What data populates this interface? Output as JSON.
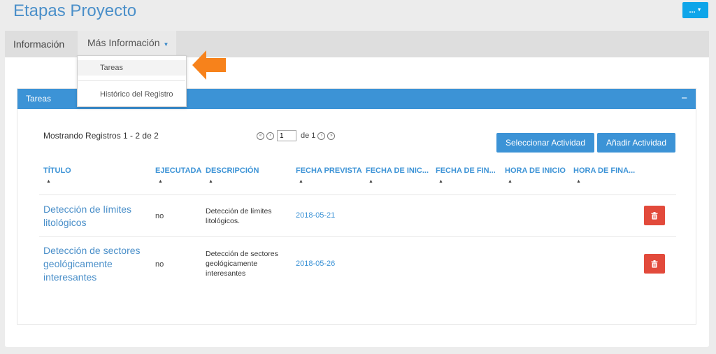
{
  "header": {
    "title": "Etapas Proyecto",
    "menu_label": "...",
    "menu_caret": "▼"
  },
  "tabs": [
    {
      "label": "Información"
    },
    {
      "label": "Más Información",
      "caret": "▼"
    }
  ],
  "dropdown": {
    "items": [
      {
        "label": "Tareas"
      },
      {
        "label": "Histórico del Registro"
      }
    ]
  },
  "panel": {
    "title": "Tareas",
    "collapse_symbol": "−",
    "records_info": "Mostrando Registros 1 - 2 de 2",
    "pager": {
      "first": "«",
      "prev": "‹",
      "current_page": "1",
      "of_label": "de 1",
      "next": "›",
      "last": "»"
    },
    "buttons": {
      "select_activity": "Seleccionar Actividad",
      "add_activity": "Añadir Actividad"
    },
    "columns": [
      {
        "label": "TÍTULO",
        "sort": "▲"
      },
      {
        "label": "EJECUTADA",
        "sort": "▲"
      },
      {
        "label": "DESCRIPCIÓN",
        "sort": "▲"
      },
      {
        "label": "FECHA PREVISTA",
        "sort": "▲"
      },
      {
        "label": "FECHA DE INIC...",
        "sort": "▲"
      },
      {
        "label": "FECHA DE FIN...",
        "sort": "▲"
      },
      {
        "label": "HORA DE INICIO",
        "sort": "▲"
      },
      {
        "label": "HORA DE FINA...",
        "sort": "▲"
      }
    ],
    "rows": [
      {
        "title": "Detección de límites litológicos",
        "executed": "no",
        "description": "Detección de límites litológicos.",
        "planned_date": "2018-05-21"
      },
      {
        "title": "Detección de sectores geológicamente interesantes",
        "executed": "no",
        "description": "Detección de sectores geológicamente interesantes",
        "planned_date": "2018-05-26"
      }
    ]
  },
  "colors": {
    "accent": "#3c93d6",
    "title": "#4a8fc9",
    "delete": "#e24a3b",
    "callout_arrow": "#f7821b"
  }
}
